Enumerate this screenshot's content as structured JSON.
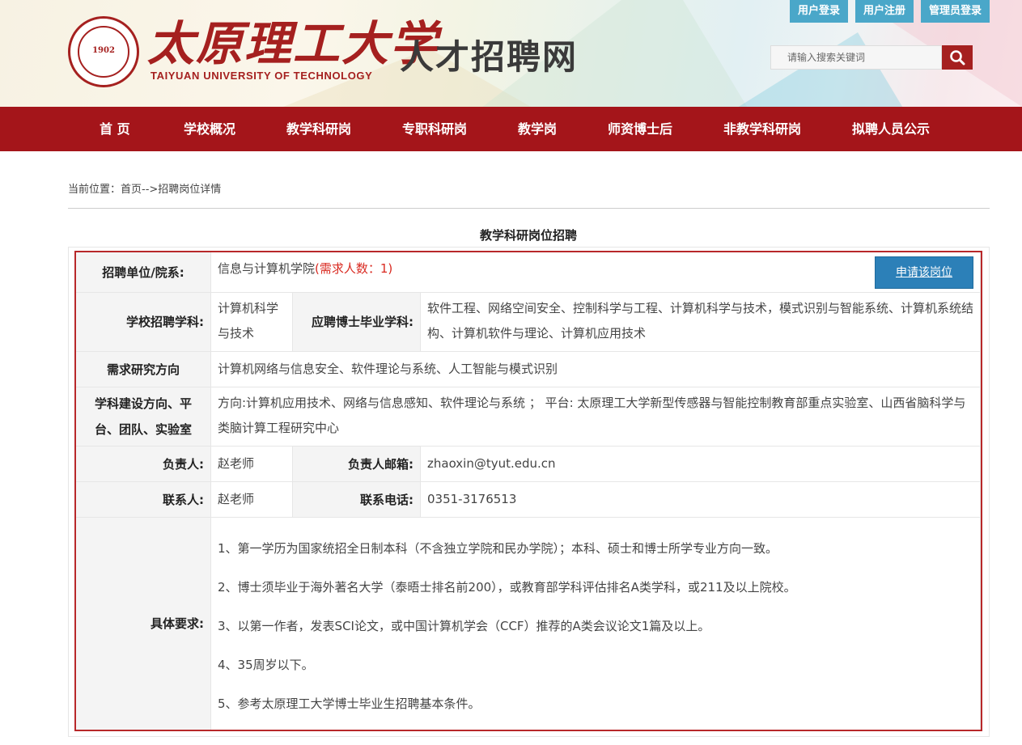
{
  "header": {
    "logo_cn": "太原理工大学",
    "logo_en": "TAIYUAN UNIVERSITY OF TECHNOLOGY",
    "seal_year": "1902",
    "site_name": "人才招聘网",
    "top_links": [
      "用户登录",
      "用户注册",
      "管理员登录"
    ],
    "search_placeholder": "请输入搜索关键词",
    "search_icon": "search-icon"
  },
  "nav": {
    "items": [
      "首 页",
      "学校概况",
      "教学科研岗",
      "专职科研岗",
      "教学岗",
      "师资博士后",
      "非教学科研岗",
      "拟聘人员公示"
    ]
  },
  "breadcrumb": "当前位置：首页-->招聘岗位详情",
  "section_title": "教学科研岗位招聘",
  "job": {
    "unit_label": "招聘单位/院系:",
    "unit_value": "信息与计算机学院",
    "demand_text": "(需求人数：1)",
    "apply_button": "申请该岗位",
    "subject_label": "学校招聘学科:",
    "subject_value": "计算机科学与技术",
    "phd_label": "应聘博士毕业学科:",
    "phd_value": "软件工程、网络空间安全、控制科学与工程、计算机科学与技术，模式识别与智能系统、计算机系统结构、计算机软件与理论、计算机应用技术",
    "direction_label": "需求研究方向",
    "direction_value": "计算机网络与信息安全、软件理论与系统、人工智能与模式识别",
    "platform_label": "学科建设方向、平台、团队、实验室",
    "platform_value": "方向:计算机应用技术、网络与信息感知、软件理论与系统 ； 平台: 太原理工大学新型传感器与智能控制教育部重点实验室、山西省脑科学与类脑计算工程研究中心",
    "leader_label": "负责人:",
    "leader_value": "赵老师",
    "email_label": "负责人邮箱:",
    "email_value": "zhaoxin@tyut.edu.cn",
    "contact_label": "联系人:",
    "contact_value": "赵老师",
    "phone_label": "联系电话:",
    "phone_value": "0351-3176513",
    "requirements_label": "具体要求:",
    "requirements": [
      "1、第一学历为国家统招全日制本科（不含独立学院和民办学院）；本科、硕士和博士所学专业方向一致。",
      "2、博士须毕业于海外著名大学（泰晤士排名前200），或教育部学科评估排名A类学科，或211及以上院校。",
      "3、以第一作者，发表SCI论文，或中国计算机学会（CCF）推荐的A类会议论文1篇及以上。",
      "4、35周岁以下。",
      "5、参考太原理工大学博士毕业生招聘基本条件。"
    ]
  },
  "colors": {
    "brand_red": "#a4151a",
    "accent_blue": "#4aa7c9",
    "apply_blue": "#2c80b8",
    "border_red": "#b8282a"
  }
}
